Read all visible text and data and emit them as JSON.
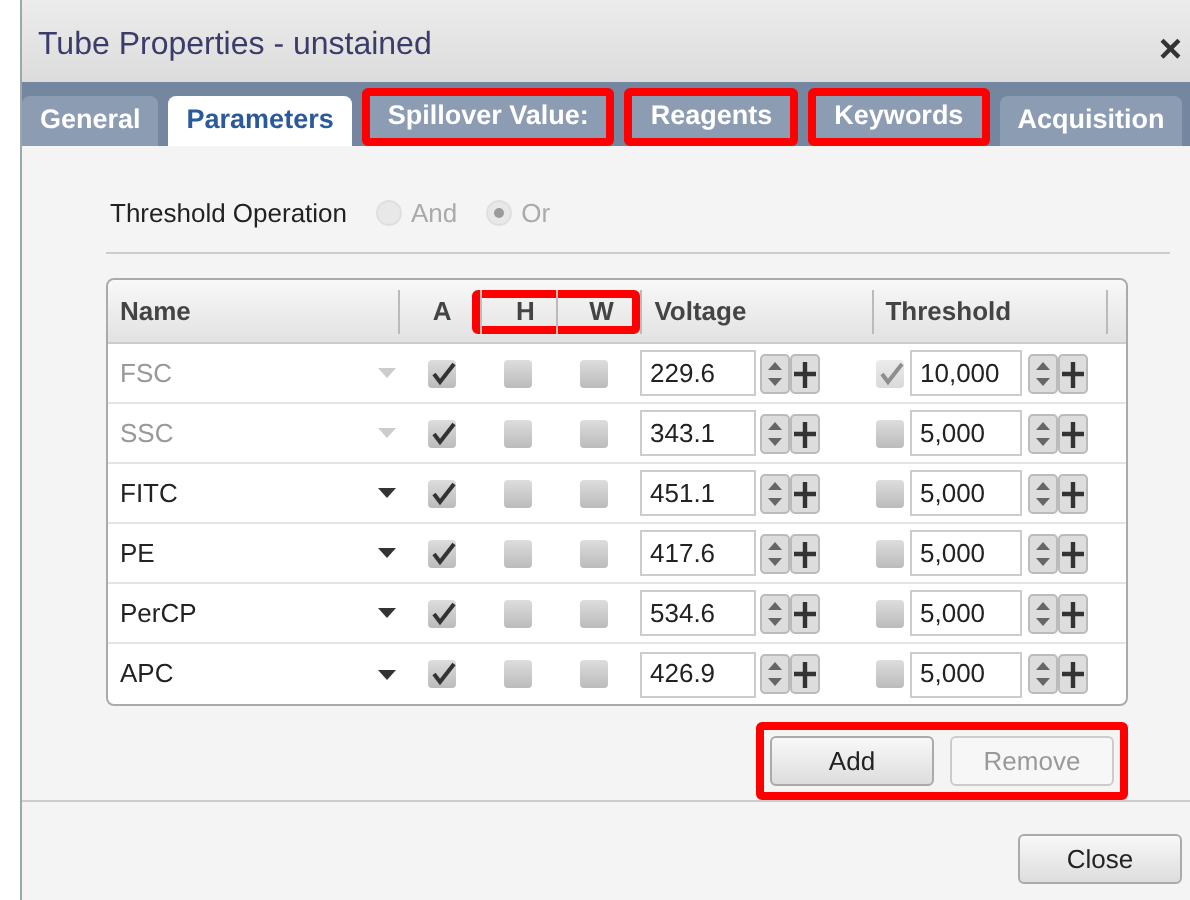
{
  "window": {
    "title": "Tube Properties - unstained",
    "close": "×"
  },
  "tabs": [
    {
      "label": "General",
      "selected": false,
      "highlighted": false
    },
    {
      "label": "Parameters",
      "selected": true,
      "highlighted": false
    },
    {
      "label": "Spillover Value:",
      "selected": false,
      "highlighted": true
    },
    {
      "label": "Reagents",
      "selected": false,
      "highlighted": true
    },
    {
      "label": "Keywords",
      "selected": false,
      "highlighted": true
    },
    {
      "label": "Acquisition",
      "selected": false,
      "highlighted": false
    }
  ],
  "threshold_operation": {
    "label": "Threshold Operation",
    "options": [
      {
        "label": "And",
        "selected": false,
        "disabled": true
      },
      {
        "label": "Or",
        "selected": true,
        "disabled": true
      }
    ]
  },
  "table": {
    "columns": [
      {
        "label": "Name",
        "highlighted": false
      },
      {
        "label": "A",
        "highlighted": false
      },
      {
        "label": "H",
        "highlighted": true
      },
      {
        "label": "W",
        "highlighted": true
      },
      {
        "label": "Voltage",
        "highlighted": false
      },
      {
        "label": "Threshold",
        "highlighted": false
      }
    ],
    "rows": [
      {
        "name": "FSC",
        "disabled": true,
        "a": true,
        "h": false,
        "w": false,
        "voltage": "229.6",
        "threshold_checked": true,
        "threshold_disabled": true,
        "threshold": "10,000"
      },
      {
        "name": "SSC",
        "disabled": true,
        "a": true,
        "h": false,
        "w": false,
        "voltage": "343.1",
        "threshold_checked": false,
        "threshold_disabled": false,
        "threshold": "5,000"
      },
      {
        "name": "FITC",
        "disabled": false,
        "a": true,
        "h": false,
        "w": false,
        "voltage": "451.1",
        "threshold_checked": false,
        "threshold_disabled": false,
        "threshold": "5,000"
      },
      {
        "name": "PE",
        "disabled": false,
        "a": true,
        "h": false,
        "w": false,
        "voltage": "417.6",
        "threshold_checked": false,
        "threshold_disabled": false,
        "threshold": "5,000"
      },
      {
        "name": "PerCP",
        "disabled": false,
        "a": true,
        "h": false,
        "w": false,
        "voltage": "534.6",
        "threshold_checked": false,
        "threshold_disabled": false,
        "threshold": "5,000"
      },
      {
        "name": "APC",
        "disabled": false,
        "a": true,
        "h": false,
        "w": false,
        "voltage": "426.9",
        "threshold_checked": false,
        "threshold_disabled": false,
        "threshold": "5,000"
      }
    ]
  },
  "table_buttons": [
    {
      "label": "Add",
      "disabled": false,
      "highlighted": true
    },
    {
      "label": "Remove",
      "disabled": true,
      "highlighted": true
    }
  ],
  "footer_buttons": [
    {
      "label": "Close",
      "disabled": false
    }
  ]
}
